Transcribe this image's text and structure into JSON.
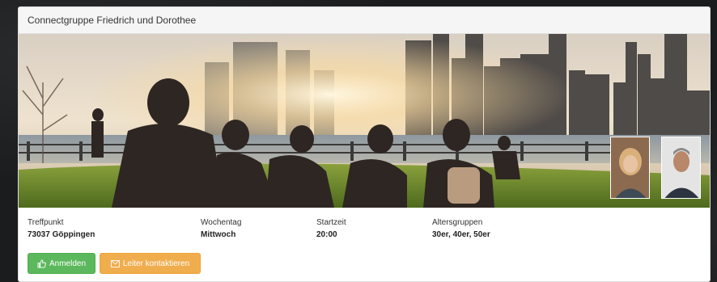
{
  "group": {
    "title": "Connectgruppe Friedrich und Dorothee"
  },
  "details": {
    "meeting_point_label": "Treffpunkt",
    "meeting_point_value": "73037 Göppingen",
    "weekday_label": "Wochentag",
    "weekday_value": "Mittwoch",
    "start_time_label": "Startzeit",
    "start_time_value": "20:00",
    "age_groups_label": "Altersgruppen",
    "age_groups_value": "30er, 40er, 50er"
  },
  "actions": {
    "register_label": "Anmelden",
    "register_icon": "thumbs-up-icon",
    "contact_label": "Leiter kontaktieren",
    "contact_icon": "envelope-icon"
  },
  "colors": {
    "register_button": "#5cb85c",
    "contact_button": "#f0ad4e"
  },
  "leaders": [
    {
      "name": "leader-avatar-female"
    },
    {
      "name": "leader-avatar-male"
    }
  ]
}
